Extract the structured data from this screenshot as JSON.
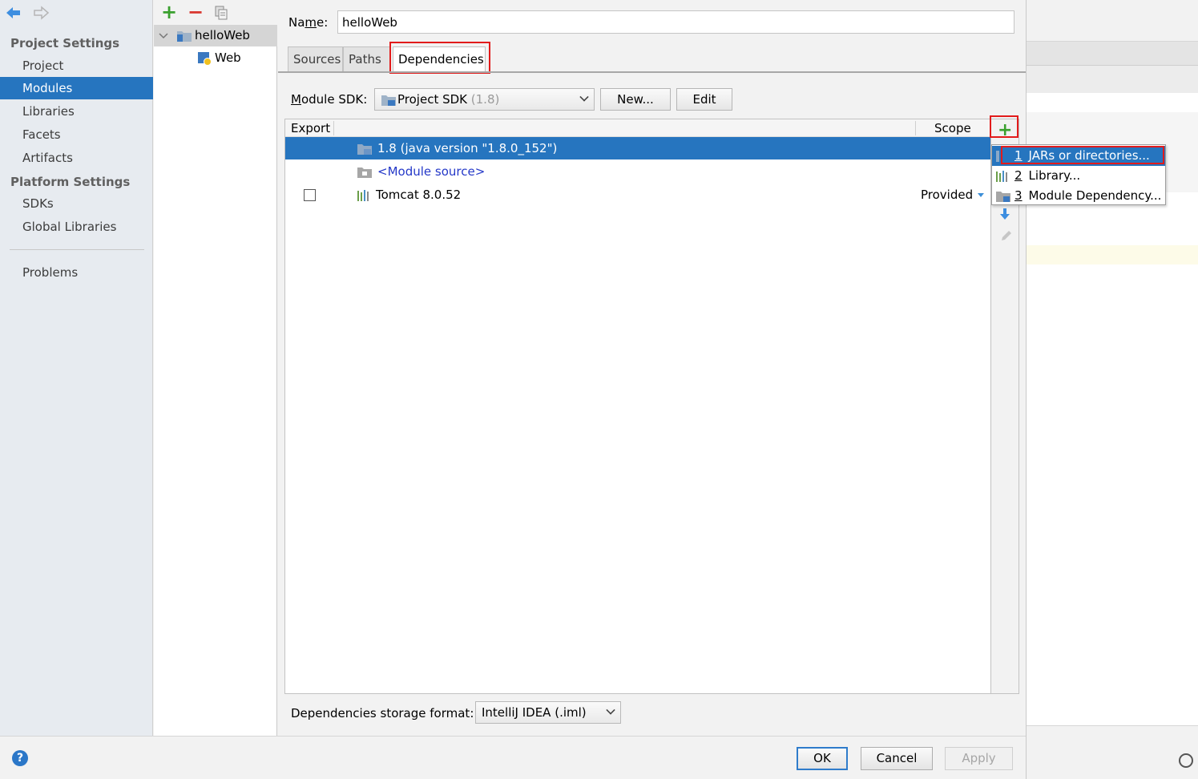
{
  "sidebar": {
    "project_settings_heading": "Project Settings",
    "project_items": [
      {
        "label": "Project"
      },
      {
        "label": "Modules"
      },
      {
        "label": "Libraries"
      },
      {
        "label": "Facets"
      },
      {
        "label": "Artifacts"
      }
    ],
    "platform_settings_heading": "Platform Settings",
    "platform_items": [
      {
        "label": "SDKs"
      },
      {
        "label": "Global Libraries"
      }
    ],
    "problems_label": "Problems",
    "selected_item": "Modules"
  },
  "module_tree": {
    "items": [
      {
        "label": "helloWeb",
        "expanded": true,
        "icon": "module-folder-icon"
      },
      {
        "label": "Web",
        "icon": "web-facet-icon"
      }
    ]
  },
  "module": {
    "name_label_prefix": "Na",
    "name_label_mnemonic": "m",
    "name_label_suffix": "e:",
    "name_value": "helloWeb",
    "tabs": [
      {
        "label": "Sources"
      },
      {
        "label": "Paths"
      },
      {
        "label": "Dependencies"
      }
    ],
    "active_tab": "Dependencies"
  },
  "sdk": {
    "label_mnemonic": "M",
    "label_rest": "odule SDK:",
    "selected": "Project SDK",
    "selected_version": "(1.8)",
    "new_button": "New...",
    "edit_button": "Edit"
  },
  "dependencies_table": {
    "headers": {
      "export": "Export",
      "scope": "Scope"
    },
    "rows": [
      {
        "name": "1.8 (java version \"1.8.0_152\")",
        "scope": "",
        "has_checkbox": false,
        "selected": true,
        "icon": "jdk-folder-icon"
      },
      {
        "name": "<Module source>",
        "scope": "",
        "has_checkbox": false,
        "selected": false,
        "icon": "source-folder-icon"
      },
      {
        "name": "Tomcat 8.0.52",
        "scope": "Provided",
        "has_checkbox": true,
        "checked": false,
        "selected": false,
        "icon": "library-icon"
      }
    ]
  },
  "add_popup": {
    "items": [
      {
        "mnemonic": "1",
        "label": "JARs or directories...",
        "icon": "jar-icon"
      },
      {
        "mnemonic": "2",
        "label": "Library...",
        "icon": "library-icon"
      },
      {
        "mnemonic": "3",
        "label": "Module Dependency...",
        "icon": "module-folder-icon"
      }
    ],
    "selected_index": 0
  },
  "storage": {
    "label": "Dependencies storage format:",
    "value": "IntelliJ IDEA (.iml)"
  },
  "footer": {
    "help": "?",
    "ok": "OK",
    "cancel": "Cancel",
    "apply": "Apply"
  },
  "colors": {
    "selection": "#2675bf",
    "highlight_box": "#e21b1b",
    "add_green": "#3aa02e",
    "remove_red": "#d9372f"
  }
}
